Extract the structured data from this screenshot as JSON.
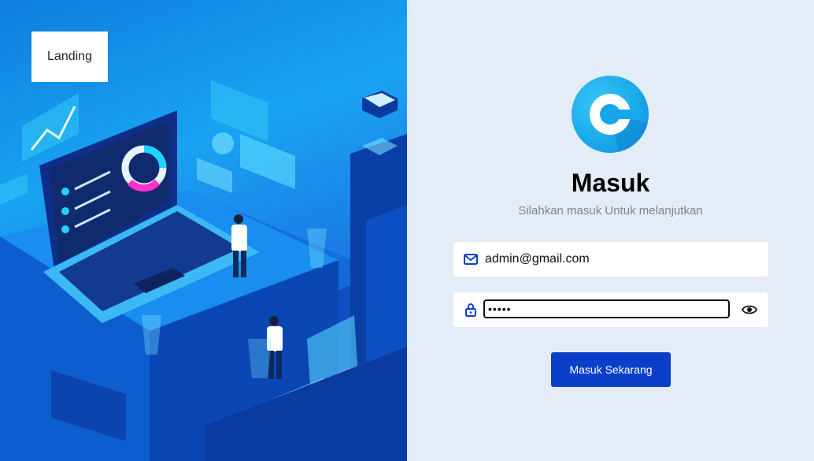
{
  "landing_button": {
    "label": "Landing"
  },
  "login": {
    "title": "Masuk",
    "subtitle": "Silahkan masuk Untuk melanjutkan",
    "email": {
      "value": "admin@gmail.com",
      "icon": "mail-icon"
    },
    "password": {
      "masked_value": "•••••",
      "icon": "lock-icon",
      "toggle_icon": "eye-icon"
    },
    "submit_label": "Masuk Sekarang"
  },
  "colors": {
    "accent": "#0b3fca",
    "panel_bg": "#e4ecf8",
    "logo": "#17a6ea"
  }
}
